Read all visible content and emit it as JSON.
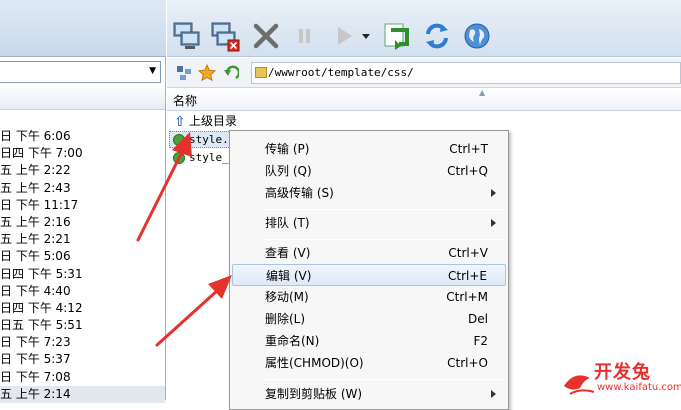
{
  "remote": {
    "path": "/wwwroot/template/css/",
    "column_name": "名称",
    "files": [
      {
        "name": "上级目录",
        "type": "parent"
      },
      {
        "name": "style.c",
        "type": "css"
      },
      {
        "name": "style_b",
        "type": "css"
      }
    ]
  },
  "local": {
    "dates": [
      "日 下午 6:06",
      "日四 下午 7:00",
      "五 上午 2:22",
      "五 上午 2:43",
      "日 下午 11:17",
      "五 上午 2:16",
      "五 上午 2:21",
      "日 下午 5:06",
      "日四 下午 5:31",
      "日 下午 4:40",
      "日四 下午 4:12",
      "日五 下午 5:51",
      "日 下午 7:23",
      "日 下午 5:37",
      "日 下午 7:08",
      "五 上午 2:14"
    ]
  },
  "toolbar": {
    "icons": [
      "connect-icon",
      "disconnect-icon",
      "stop-icon",
      "pause-icon",
      "play-icon",
      "dropdown-icon",
      "transfer-icon",
      "refresh-icon",
      "globe-icon"
    ]
  },
  "menu": {
    "items": [
      {
        "label": "传输 (P)",
        "shortcut": "Ctrl+T",
        "submenu": false
      },
      {
        "label": "队列 (Q)",
        "shortcut": "Ctrl+Q",
        "submenu": false
      },
      {
        "label": "高级传输 (S)",
        "shortcut": "",
        "submenu": true
      },
      {
        "label": "排队 (T)",
        "shortcut": "",
        "submenu": true
      },
      {
        "label": "查看 (V)",
        "shortcut": "Ctrl+V",
        "submenu": false
      },
      {
        "label": "编辑 (V)",
        "shortcut": "Ctrl+E",
        "submenu": false
      },
      {
        "label": "移动(M)",
        "shortcut": "Ctrl+M",
        "submenu": false
      },
      {
        "label": "删除(L)",
        "shortcut": "Del",
        "submenu": false
      },
      {
        "label": "重命名(N)",
        "shortcut": "F2",
        "submenu": false
      },
      {
        "label": "属性(CHMOD)(O)",
        "shortcut": "Ctrl+O",
        "submenu": false
      },
      {
        "label": "复制到剪贴板 (W)",
        "shortcut": "",
        "submenu": true
      }
    ]
  },
  "watermark": {
    "text": "开发兔",
    "url": "www.kaifatu.com"
  },
  "colors": {
    "arrow": "#e5322d",
    "selection": "#dde8f6"
  }
}
